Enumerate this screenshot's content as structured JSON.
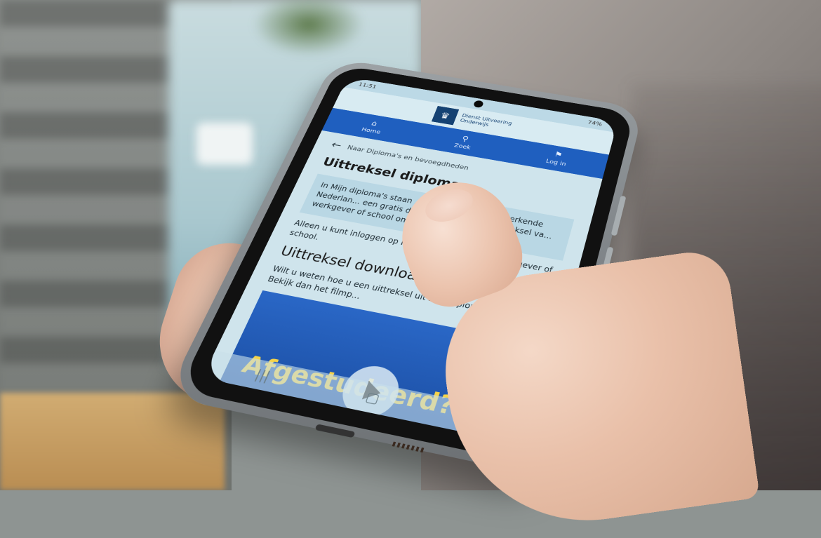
{
  "status_bar": {
    "time": "11:51",
    "battery": "74%"
  },
  "brand": {
    "line1": "Dienst Uitvoering",
    "line2": "Onderwijs"
  },
  "nav": [
    {
      "label": "Home",
      "icon": "home-icon"
    },
    {
      "label": "Zoek",
      "icon": "search-icon"
    },
    {
      "label": "Log in",
      "icon": "lock-icon"
    }
  ],
  "breadcrumb": "Naar Diploma's en bevoegdheden",
  "page_title": "Uittreksel diploma",
  "lead_text": "In Mijn diploma's staan ... de meeste, door h... erkende Nederlan... een gratis digitaal u... papieren uittreksel va... werkgever of school om b... vraagt.",
  "paragraph": "Alleen u kunt inloggen op Mijn diplom... niet een werkgever of school.",
  "section_title": "Uittreksel downloaden",
  "section_text": "Wilt u weten hoe u een uittreksel uit Mijn diploma's downloadt? Bekijk dan het filmp...",
  "video_title": "Afgestudeerd?",
  "colors": {
    "nav": "#1f5fbf",
    "logo": "#154273",
    "video_title": "#f5d34a"
  }
}
